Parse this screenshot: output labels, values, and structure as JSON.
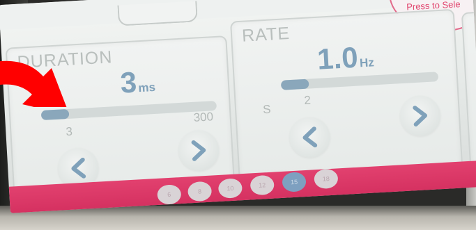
{
  "header": {
    "press_to_select": "Press to Sele"
  },
  "duration": {
    "title": "DURATION",
    "value": "3",
    "unit": "ms",
    "slider_level": 0.0,
    "min_label": "3",
    "max_label": "300",
    "decrease_icon": "chevron-left-icon",
    "increase_icon": "chevron-right-icon"
  },
  "rate": {
    "title": "RATE",
    "value": "1.0",
    "unit": "Hz",
    "slider_level": 0.0,
    "prefix_label": "S",
    "min_label": "2",
    "decrease_icon": "chevron-left-icon",
    "increase_icon": "chevron-right-icon"
  },
  "pagination": {
    "dots": [
      "6",
      "8",
      "10",
      "12",
      "15",
      "18"
    ],
    "active_index": 4
  },
  "colors": {
    "accent_value": "#7fa1ba",
    "bottom_bar": "#d12c5c",
    "pointer_arrow": "#ff0000"
  }
}
